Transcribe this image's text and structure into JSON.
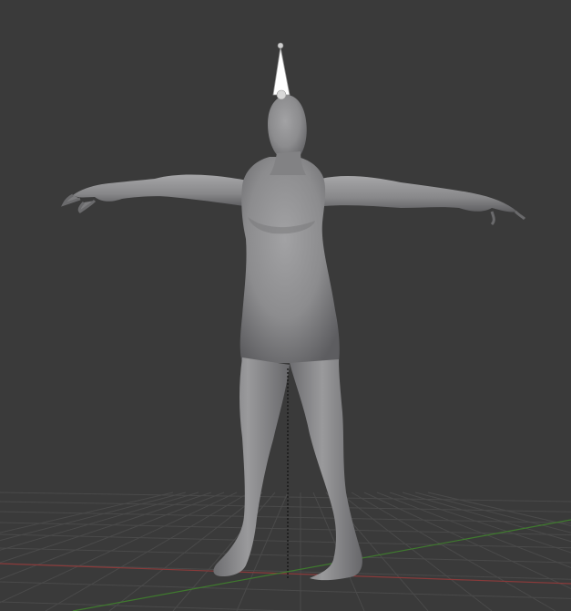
{
  "viewport": {
    "background_color": "#3a3a3a",
    "grid_color": "#4a4a4a",
    "x_axis_color": "#8a3a3a",
    "y_axis_color": "#3f7a2e"
  },
  "model": {
    "mesh_color": "#8c8c8e",
    "bone_color": "#ffffff",
    "pose": "T-pose"
  },
  "object_origin_line": {
    "style": "dashed",
    "color": "#111111"
  }
}
